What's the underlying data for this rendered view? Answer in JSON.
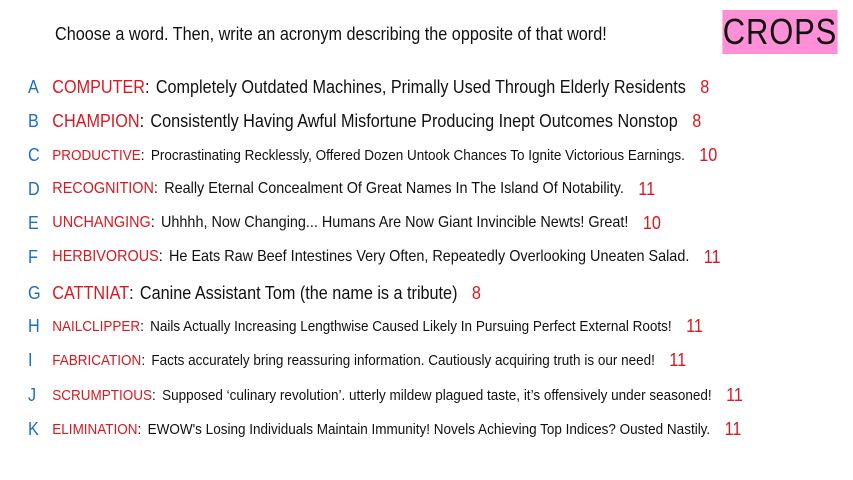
{
  "header": {
    "prompt": "Choose a word. Then, write an acronym describing the opposite of that word!",
    "category": "CROPS",
    "category_color": "#ff8fd6"
  },
  "colors": {
    "letter": "#1c6fc2",
    "word": "#d71921",
    "text": "#111111",
    "score": "#d71921"
  },
  "entries": [
    {
      "letter": "A",
      "word": "COMPUTER",
      "separator": ":",
      "expansion": "Completely Outdated Machines, Primally Used Through Elderly Residents",
      "score": "8"
    },
    {
      "letter": "B",
      "word": "CHAMPION",
      "separator": ":",
      "expansion": "Consistently Having Awful Misfortune Producing Inept Outcomes Nonstop",
      "score": "8"
    },
    {
      "letter": "C",
      "word": "PRODUCTIVE",
      "separator": ":",
      "expansion": "Procrastinating Recklessly, Offered Dozen Untook Chances To Ignite Victorious Earnings.",
      "score": "10"
    },
    {
      "letter": "D",
      "word": "RECOGNITION",
      "separator": ":",
      "expansion": "Really Eternal Concealment Of Great Names In The Island Of Notability.",
      "score": "11"
    },
    {
      "letter": "E",
      "word": "UNCHANGING",
      "separator": ":",
      "expansion": "Uhhhh, Now Changing... Humans Are Now Giant Invincible Newts! Great!",
      "score": "10"
    },
    {
      "letter": "F",
      "word": "HERBIVOROUS",
      "separator": ":",
      "expansion": "He Eats Raw Beef Intestines Very Often, Repeatedly Overlooking Uneaten Salad.",
      "score": "11"
    },
    {
      "letter": "G",
      "word": "CATTNIAT",
      "separator": ":",
      "expansion": "Canine Assistant Tom (the name is a tribute)",
      "score": "8"
    },
    {
      "letter": "H",
      "word": "NAILCLIPPER",
      "separator": ":",
      "expansion": "Nails Actually Increasing Lengthwise Caused Likely In Pursuing Perfect External Roots!",
      "score": "11"
    },
    {
      "letter": "I",
      "word": "FABRICATION",
      "separator": ":",
      "expansion": "Facts accurately bring reassuring information. Cautiously acquiring truth is our need!",
      "score": "11"
    },
    {
      "letter": "J",
      "word": "SCRUMPTIOUS",
      "separator": ":",
      "expansion": "Supposed ‘culinary revolution’. utterly mildew plagued taste, it’s offensively under seasoned!",
      "score": "11"
    },
    {
      "letter": "K",
      "word": "ELIMINATION",
      "separator": ":",
      "expansion": "EWOW's Losing Individuals Maintain Immunity! Novels Achieving Top Indices? Ousted Nastily.",
      "score": "11"
    }
  ]
}
